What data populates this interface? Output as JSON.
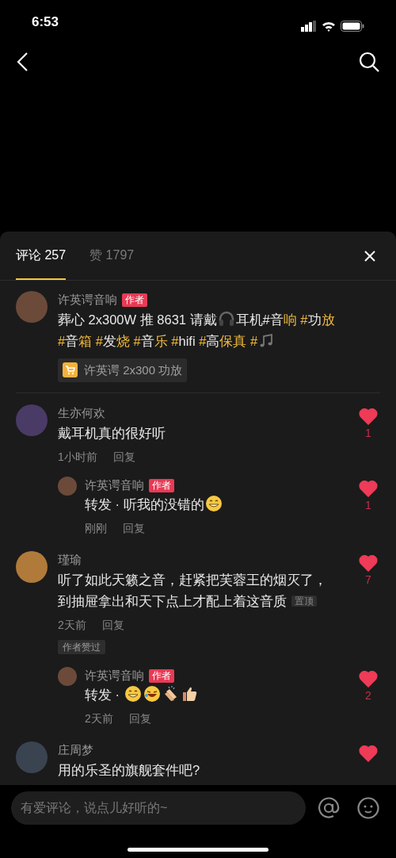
{
  "status_bar": {
    "time": "6:53"
  },
  "tabs": [
    {
      "label": "评论 257",
      "selected": true
    },
    {
      "label": "赞 1797",
      "selected": false
    }
  ],
  "post": {
    "author": "许英谔音响",
    "badge": "作者",
    "segments": [
      {
        "kind": "text",
        "text": "葬心 2x300W 推 8631 请戴",
        "highlight": false
      },
      {
        "kind": "headphones"
      },
      {
        "kind": "text",
        "text": "耳机#音",
        "highlight": false
      },
      {
        "kind": "text",
        "text": "响 #",
        "highlight": true
      },
      {
        "kind": "text",
        "text": "功",
        "highlight": false
      },
      {
        "kind": "text",
        "text": "放 #",
        "highlight": true
      },
      {
        "kind": "text",
        "text": "音",
        "highlight": false
      },
      {
        "kind": "text",
        "text": "箱 #",
        "highlight": true
      },
      {
        "kind": "text",
        "text": "发",
        "highlight": false
      },
      {
        "kind": "text",
        "text": "烧 #",
        "highlight": true
      },
      {
        "kind": "text",
        "text": "音",
        "highlight": false
      },
      {
        "kind": "text",
        "text": "乐 #",
        "highlight": true
      },
      {
        "kind": "text",
        "text": "hifi",
        "highlight": false
      },
      {
        "kind": "text",
        "text": " #",
        "highlight": true
      },
      {
        "kind": "text",
        "text": "高",
        "highlight": false
      },
      {
        "kind": "text",
        "text": "保真 #",
        "highlight": true
      },
      {
        "kind": "note"
      }
    ],
    "product": "许英谔 2x300 功放"
  },
  "comments": [
    {
      "name": "生亦何欢",
      "segments": [
        {
          "kind": "text",
          "text": "戴耳机真的很好听",
          "highlight": false
        }
      ],
      "time": "1小时前",
      "reply": "回复",
      "liked": true,
      "likes": "1",
      "replies": [
        {
          "name": "许英谔音响",
          "badge": "作者",
          "segments": [
            {
              "kind": "text",
              "text": "转发 · 听我的没错的",
              "highlight": false
            },
            {
              "kind": "grin"
            }
          ],
          "time": "刚刚",
          "reply": "回复",
          "liked": true,
          "likes": "1"
        }
      ]
    },
    {
      "name": "瑾瑜",
      "segments": [
        {
          "kind": "text",
          "text": "听了如此天籁之音，赶紧把芙蓉王的烟灭了，到抽屉拿出和天下点上才配上着这音质",
          "highlight": false
        }
      ],
      "pinned": "置顶",
      "time": "2天前",
      "reply": "回复",
      "author_liked": "作者赞过",
      "liked": true,
      "likes": "7",
      "replies": [
        {
          "name": "许英谔音响",
          "badge": "作者",
          "segments": [
            {
              "kind": "text",
              "text": "转发 · ",
              "highlight": false
            },
            {
              "kind": "grin"
            },
            {
              "kind": "laugh"
            },
            {
              "kind": "clap"
            },
            {
              "kind": "thumb"
            }
          ],
          "time": "2天前",
          "reply": "回复",
          "liked": true,
          "likes": "2"
        }
      ]
    },
    {
      "name": "庄周梦",
      "segments": [
        {
          "kind": "text",
          "text": "用的乐圣的旗舰套件吧?",
          "highlight": false
        }
      ],
      "liked": true
    }
  ],
  "input": {
    "placeholder": "有爱评论，说点儿好听的~"
  }
}
